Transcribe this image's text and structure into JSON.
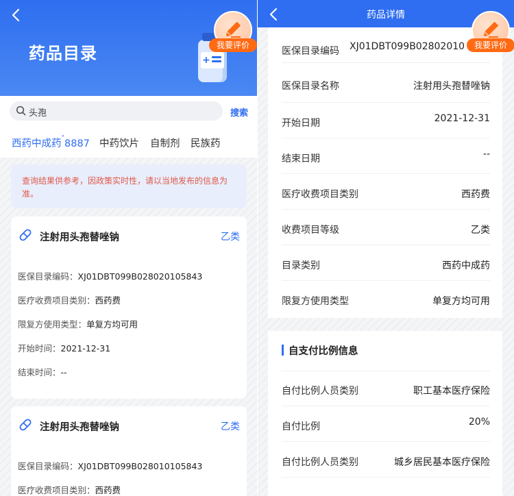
{
  "list_screen": {
    "title": "药品目录",
    "eval_badge": "我要评价",
    "search": {
      "value": "头孢",
      "button": "搜索"
    },
    "tabs": [
      {
        "label": "西药中成药",
        "count": "8887",
        "active": true
      },
      {
        "label": "中药饮片",
        "active": false
      },
      {
        "label": "自制剂",
        "active": false
      },
      {
        "label": "民族药",
        "active": false
      }
    ],
    "notice": "查询结果供参考，因政策实时性，请以当地发布的信息为准。",
    "cards": [
      {
        "name": "注射用头孢替唑钠",
        "class": "乙类",
        "fields": [
          {
            "label": "医保目录编码：",
            "value": "XJ01DBT099B028020105843"
          },
          {
            "label": "医疗收费项目类别：",
            "value": "西药费"
          },
          {
            "label": "限复方使用类型：",
            "value": "单复方均可用"
          },
          {
            "label": "开始时间：",
            "value": "2021-12-31"
          },
          {
            "label": "结束时间：",
            "value": "--"
          }
        ]
      },
      {
        "name": "注射用头孢替唑钠",
        "class": "乙类",
        "fields": [
          {
            "label": "医保目录编码：",
            "value": "XJ01DBT099B028010105843"
          },
          {
            "label": "医疗收费项目类别：",
            "value": "西药费"
          }
        ]
      }
    ]
  },
  "detail_screen": {
    "title": "药品详情",
    "eval_badge": "我要评价",
    "details": [
      {
        "label": "医保目录编码",
        "value": "XJ01DBT099B02802010"
      },
      {
        "label": "医保目录名称",
        "value": "注射用头孢替唑钠"
      },
      {
        "label": "开始日期",
        "value": "2021-12-31"
      },
      {
        "label": "结束日期",
        "value": "--"
      },
      {
        "label": "医疗收费项目类别",
        "value": "西药费"
      },
      {
        "label": "收费项目等级",
        "value": "乙类"
      },
      {
        "label": "目录类别",
        "value": "西药中成药"
      },
      {
        "label": "限复方使用类型",
        "value": "单复方均可用"
      }
    ],
    "ratio_section": {
      "title": "自支付比例信息",
      "rows": [
        {
          "label": "自付比例人员类别",
          "value": "职工基本医疗保险"
        },
        {
          "label": "自付比例",
          "value": "20%"
        },
        {
          "label": "自付比例人员类别",
          "value": "城乡居民基本医疗保险"
        }
      ]
    }
  },
  "colors": {
    "primary": "#2f6ef0",
    "accent": "#ff6a13",
    "notice_text": "#e0584b"
  },
  "icons": [
    "back-arrow-icon",
    "edit-pencil-icon",
    "medicine-bottle-icon",
    "search-icon",
    "capsule-icon"
  ]
}
